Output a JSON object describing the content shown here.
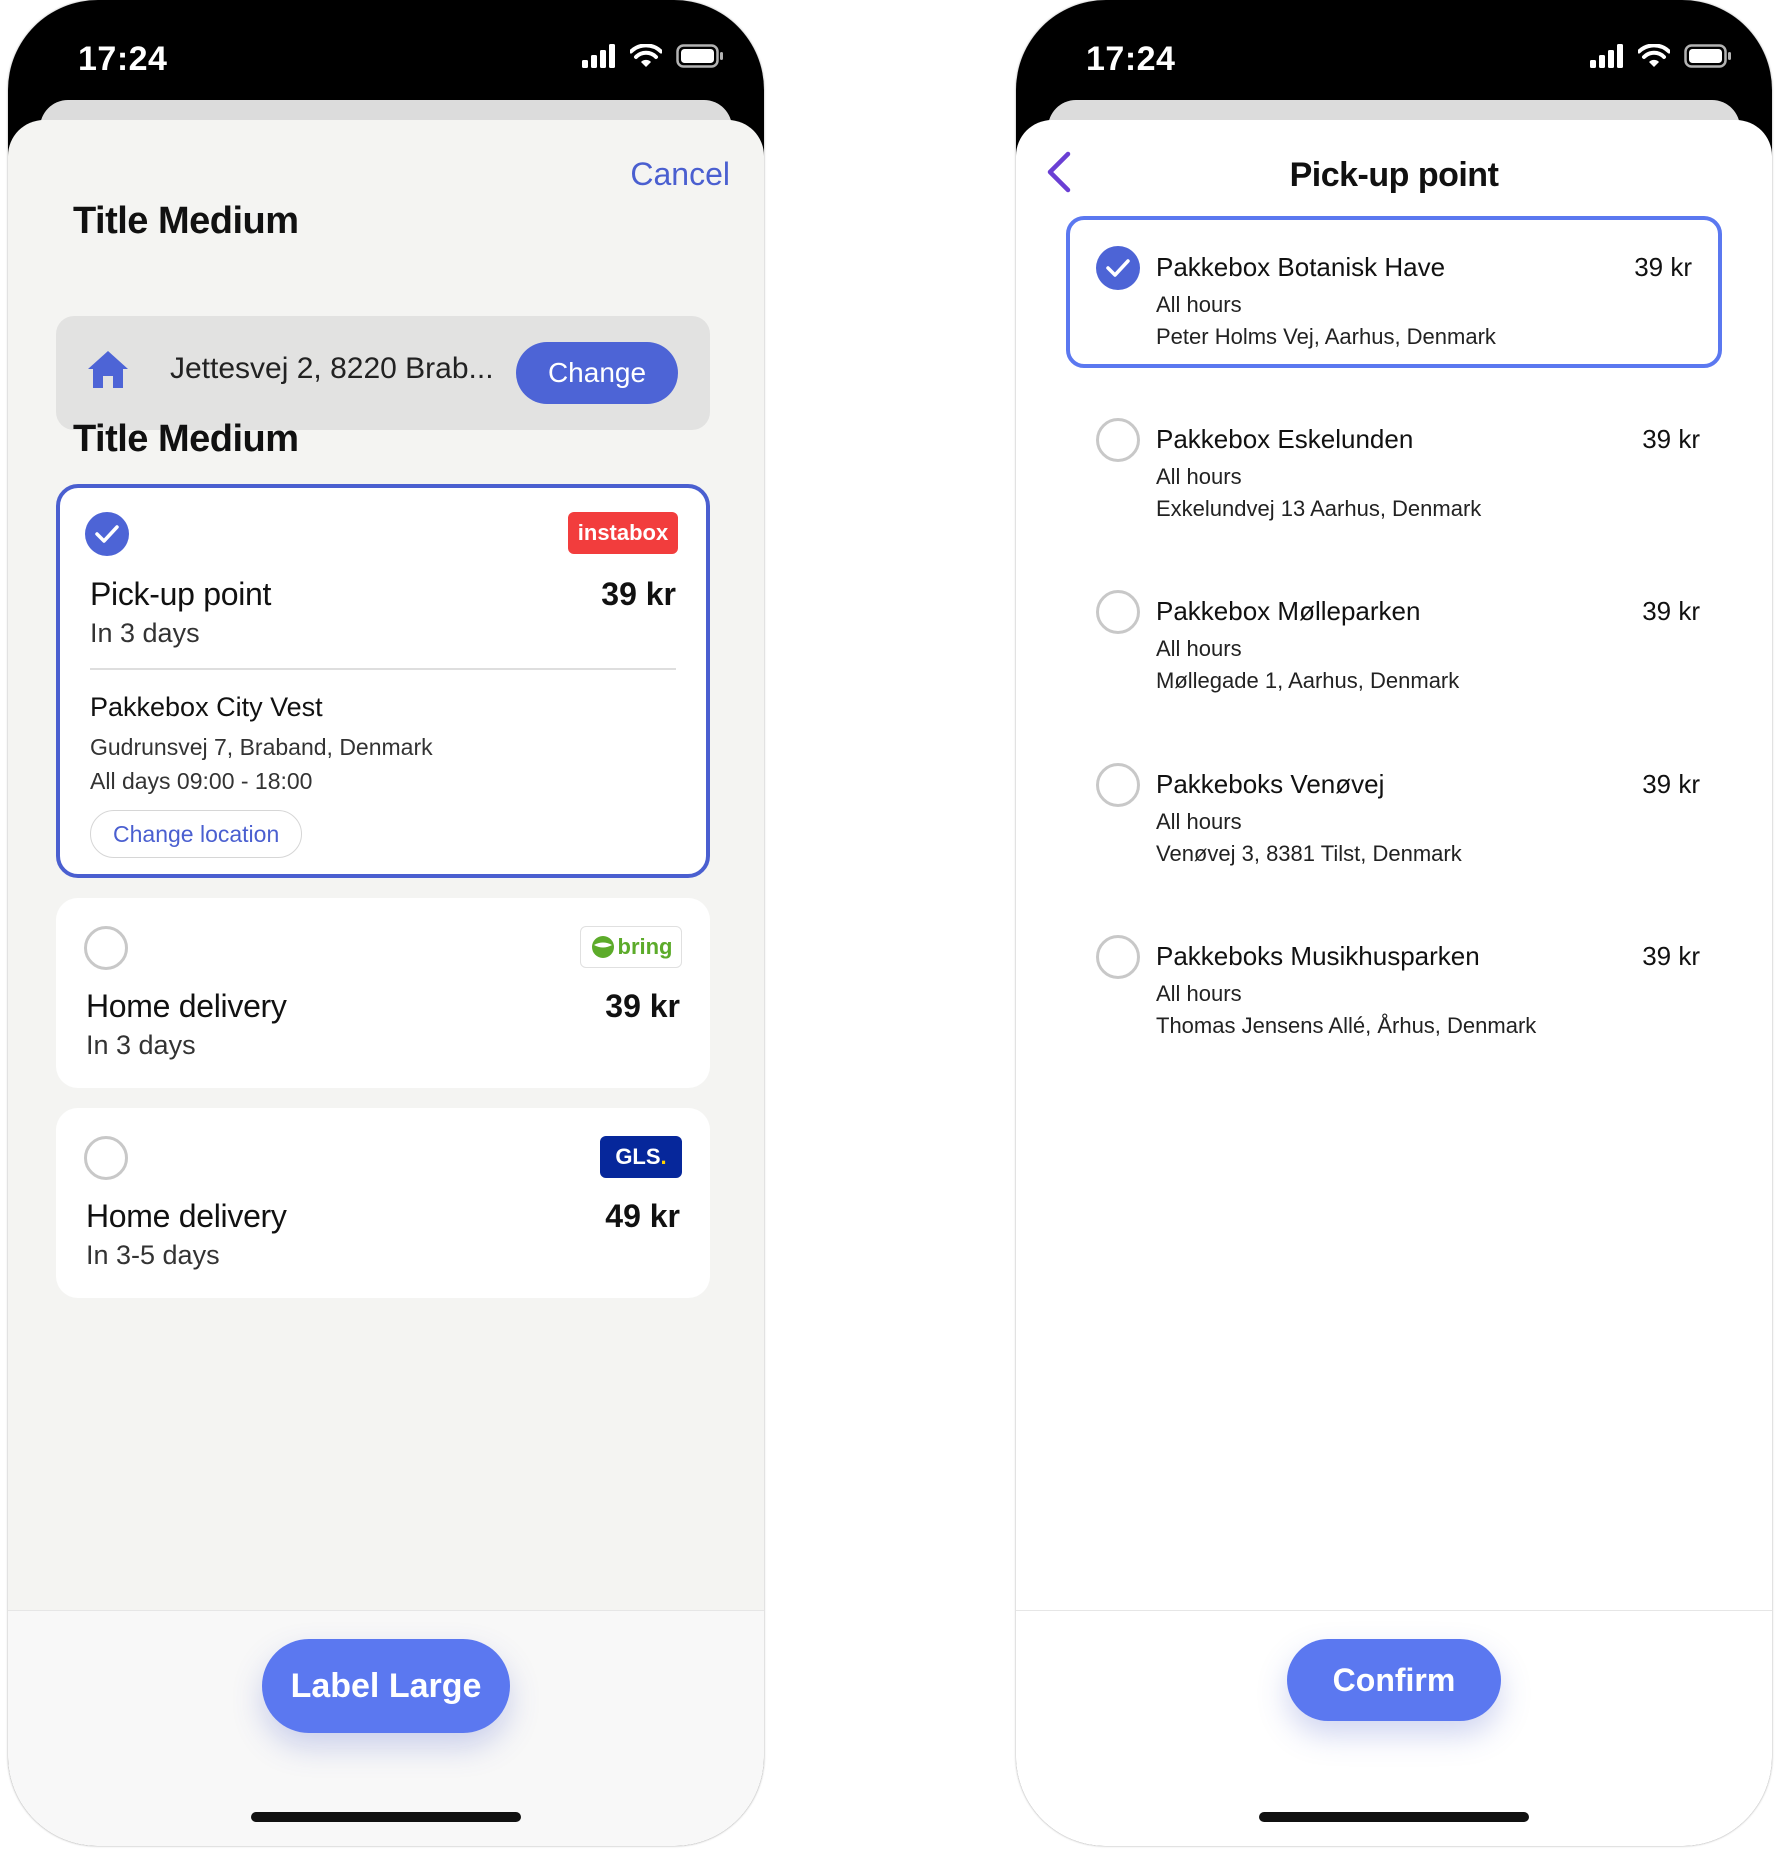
{
  "colors": {
    "accent": "#4d64d6",
    "primary_button": "#5b78f0",
    "instabox_red": "#f23d3d",
    "bring_green": "#5cab2a",
    "gls_blue": "#06279b",
    "gls_yellow": "#ffd100"
  },
  "left_screen": {
    "status": {
      "time": "17:24"
    },
    "cancel_label": "Cancel",
    "section1_title": "Title Medium",
    "address": {
      "icon": "home-icon",
      "text": "Jettesvej 2, 8220 Brab...",
      "change_label": "Change"
    },
    "section2_title": "Title Medium",
    "options": [
      {
        "carrier": "instabox",
        "label": "Pick-up point",
        "price": "39 kr",
        "eta": "In 3 days",
        "selected": true,
        "location": {
          "name": "Pakkebox City Vest",
          "address": "Gudrunsvej 7, Braband, Denmark",
          "hours": "All days 09:00 - 18:00",
          "change_label": "Change location"
        }
      },
      {
        "carrier": "bring",
        "label": "Home delivery",
        "price": "39 kr",
        "eta": "In 3 days",
        "selected": false
      },
      {
        "carrier": "GLS",
        "label": "Home delivery",
        "price": "49 kr",
        "eta": "In 3-5 days",
        "selected": false
      }
    ],
    "primary_button": "Label Large"
  },
  "right_screen": {
    "status": {
      "time": "17:24"
    },
    "title": "Pick-up point",
    "points": [
      {
        "name": "Pakkebox Botanisk Have",
        "price": "39 kr",
        "hours": "All hours",
        "address": "Peter Holms Vej, Aarhus, Denmark",
        "selected": true
      },
      {
        "name": "Pakkebox Eskelunden",
        "price": "39 kr",
        "hours": "All hours",
        "address": "Exkelundvej 13 Aarhus, Denmark",
        "selected": false
      },
      {
        "name": "Pakkebox Mølleparken",
        "price": "39 kr",
        "hours": "All hours",
        "address": "Møllegade 1, Aarhus, Denmark",
        "selected": false
      },
      {
        "name": "Pakkeboks Venøvej",
        "price": "39 kr",
        "hours": "All hours",
        "address": "Venøvej 3, 8381 Tilst, Denmark",
        "selected": false
      },
      {
        "name": "Pakkeboks Musikhusparken",
        "price": "39 kr",
        "hours": "All hours",
        "address": "Thomas Jensens Allé, Århus, Denmark",
        "selected": false
      }
    ],
    "confirm_label": "Confirm"
  }
}
